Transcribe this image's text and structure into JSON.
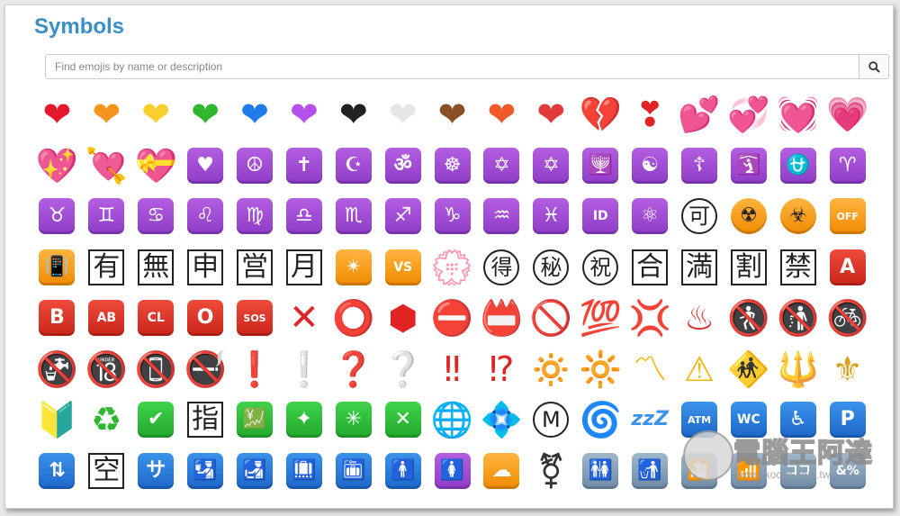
{
  "page": {
    "title": "Symbols",
    "search_placeholder": "Find emojis by name or description",
    "search_button_icon": "search-icon"
  },
  "watermark": {
    "text": "電腦王阿達",
    "url": "www.kocpc.com.tw"
  },
  "emojis": [
    {
      "name": "red-heart",
      "glyph": "❤",
      "color": "#e4182a",
      "kind": "plain"
    },
    {
      "name": "orange-heart",
      "glyph": "❤",
      "color": "#f7941d",
      "kind": "plain"
    },
    {
      "name": "yellow-heart",
      "glyph": "❤",
      "color": "#f8cf2c",
      "kind": "plain"
    },
    {
      "name": "green-heart",
      "glyph": "❤",
      "color": "#2fb82f",
      "kind": "plain"
    },
    {
      "name": "blue-heart",
      "glyph": "❤",
      "color": "#1f7bea",
      "kind": "plain"
    },
    {
      "name": "purple-heart",
      "glyph": "❤",
      "color": "#b550e8",
      "kind": "plain"
    },
    {
      "name": "black-heart",
      "glyph": "❤",
      "color": "#222222",
      "kind": "plain"
    },
    {
      "name": "white-heart",
      "glyph": "❤",
      "color": "#e6e6e6",
      "kind": "plain"
    },
    {
      "name": "brown-heart",
      "glyph": "❤",
      "color": "#8a5025",
      "kind": "plain"
    },
    {
      "name": "heart-on-fire",
      "glyph": "❤",
      "color": "#f05a28",
      "kind": "plain"
    },
    {
      "name": "mending-heart",
      "glyph": "❤",
      "color": "#e03a3a",
      "kind": "plain"
    },
    {
      "name": "broken-heart",
      "glyph": "💔",
      "color": "#e02424",
      "kind": "plain"
    },
    {
      "name": "heart-exclamation",
      "glyph": "❣",
      "color": "#e02424",
      "kind": "plain"
    },
    {
      "name": "two-hearts",
      "glyph": "💕",
      "color": "#f05aa0",
      "kind": "plain"
    },
    {
      "name": "revolving-hearts",
      "glyph": "💞",
      "color": "#f05aa0",
      "kind": "plain"
    },
    {
      "name": "beating-heart",
      "glyph": "💓",
      "color": "#f05aa0",
      "kind": "plain"
    },
    {
      "name": "growing-heart",
      "glyph": "💗",
      "color": "#f576b6",
      "kind": "plain"
    },
    {
      "name": "sparkling-heart",
      "glyph": "💖",
      "color": "#f05aa0",
      "kind": "plain"
    },
    {
      "name": "heart-with-arrow",
      "glyph": "💘",
      "color": "#f05aa0",
      "kind": "plain"
    },
    {
      "name": "heart-with-ribbon",
      "glyph": "💝",
      "color": "#f05aa0",
      "kind": "plain"
    },
    {
      "name": "heart-decoration",
      "glyph": "♥",
      "color": "",
      "kind": "purple"
    },
    {
      "name": "peace-symbol",
      "glyph": "☮",
      "color": "",
      "kind": "purple"
    },
    {
      "name": "latin-cross",
      "glyph": "✝",
      "color": "",
      "kind": "purple"
    },
    {
      "name": "star-and-crescent",
      "glyph": "☪",
      "color": "",
      "kind": "purple"
    },
    {
      "name": "om",
      "glyph": "ॐ",
      "color": "",
      "kind": "purple"
    },
    {
      "name": "wheel-of-dharma",
      "glyph": "☸",
      "color": "",
      "kind": "purple"
    },
    {
      "name": "star-of-david",
      "glyph": "✡",
      "color": "",
      "kind": "purple"
    },
    {
      "name": "dotted-six-pointed-star",
      "glyph": "✡",
      "color": "",
      "kind": "purple"
    },
    {
      "name": "menorah",
      "glyph": "🕎",
      "color": "",
      "kind": "purple"
    },
    {
      "name": "yin-yang",
      "glyph": "☯",
      "color": "",
      "kind": "purple"
    },
    {
      "name": "orthodox-cross",
      "glyph": "☦",
      "color": "",
      "kind": "purple"
    },
    {
      "name": "place-of-worship",
      "glyph": "🛐",
      "color": "",
      "kind": "purple"
    },
    {
      "name": "ophiuchus",
      "glyph": "⛎",
      "color": "",
      "kind": "purple"
    },
    {
      "name": "aries",
      "glyph": "♈",
      "color": "",
      "kind": "purple"
    },
    {
      "name": "taurus",
      "glyph": "♉",
      "color": "",
      "kind": "purple"
    },
    {
      "name": "gemini",
      "glyph": "♊",
      "color": "",
      "kind": "purple"
    },
    {
      "name": "cancer",
      "glyph": "♋",
      "color": "",
      "kind": "purple"
    },
    {
      "name": "leo",
      "glyph": "♌",
      "color": "",
      "kind": "purple"
    },
    {
      "name": "virgo",
      "glyph": "♍",
      "color": "",
      "kind": "purple"
    },
    {
      "name": "libra",
      "glyph": "♎",
      "color": "",
      "kind": "purple"
    },
    {
      "name": "scorpio",
      "glyph": "♏",
      "color": "",
      "kind": "purple"
    },
    {
      "name": "sagittarius",
      "glyph": "♐",
      "color": "",
      "kind": "purple"
    },
    {
      "name": "capricorn",
      "glyph": "♑",
      "color": "",
      "kind": "purple"
    },
    {
      "name": "aquarius",
      "glyph": "♒",
      "color": "",
      "kind": "purple"
    },
    {
      "name": "pisces",
      "glyph": "♓",
      "color": "",
      "kind": "purple"
    },
    {
      "name": "id-button",
      "glyph": "ID",
      "color": "",
      "kind": "purple-text"
    },
    {
      "name": "atom-symbol",
      "glyph": "⚛",
      "color": "",
      "kind": "purple"
    },
    {
      "name": "japanese-acceptable-button",
      "glyph": "可",
      "color": "",
      "kind": "circled"
    },
    {
      "name": "radioactive",
      "glyph": "☢",
      "color": "",
      "kind": "orange-round"
    },
    {
      "name": "biohazard",
      "glyph": "☣",
      "color": "",
      "kind": "orange-round"
    },
    {
      "name": "mobile-phone-off",
      "glyph": "OFF",
      "color": "",
      "kind": "orange-text"
    },
    {
      "name": "vibration-mode",
      "glyph": "📳",
      "color": "",
      "kind": "orange"
    },
    {
      "name": "japanese-not-free-of-charge-button",
      "glyph": "有",
      "color": "",
      "kind": "boxed"
    },
    {
      "name": "japanese-free-of-charge-button",
      "glyph": "無",
      "color": "",
      "kind": "boxed"
    },
    {
      "name": "japanese-application-button",
      "glyph": "申",
      "color": "",
      "kind": "boxed"
    },
    {
      "name": "japanese-open-for-business-button",
      "glyph": "営",
      "color": "",
      "kind": "boxed"
    },
    {
      "name": "japanese-monthly-amount-button",
      "glyph": "月",
      "color": "",
      "kind": "boxed"
    },
    {
      "name": "eight-pointed-star",
      "glyph": "✴",
      "color": "",
      "kind": "orange"
    },
    {
      "name": "vs-button",
      "glyph": "VS",
      "color": "",
      "kind": "orange-text"
    },
    {
      "name": "white-flower",
      "glyph": "💮",
      "color": "#e04040",
      "kind": "plain"
    },
    {
      "name": "japanese-bargain-button",
      "glyph": "得",
      "color": "",
      "kind": "circled"
    },
    {
      "name": "japanese-secret-button",
      "glyph": "秘",
      "color": "",
      "kind": "circled"
    },
    {
      "name": "japanese-congratulations-button",
      "glyph": "祝",
      "color": "",
      "kind": "circled"
    },
    {
      "name": "japanese-passing-grade-button",
      "glyph": "合",
      "color": "",
      "kind": "boxed"
    },
    {
      "name": "japanese-no-vacancy-button",
      "glyph": "満",
      "color": "",
      "kind": "boxed"
    },
    {
      "name": "japanese-discount-button",
      "glyph": "割",
      "color": "",
      "kind": "boxed"
    },
    {
      "name": "japanese-prohibited-button",
      "glyph": "禁",
      "color": "",
      "kind": "boxed"
    },
    {
      "name": "a-button-blood-type",
      "glyph": "A",
      "color": "",
      "kind": "red-text"
    },
    {
      "name": "b-button-blood-type",
      "glyph": "B",
      "color": "",
      "kind": "red-text"
    },
    {
      "name": "ab-button-blood-type",
      "glyph": "AB",
      "color": "",
      "kind": "red-text"
    },
    {
      "name": "cl-button",
      "glyph": "CL",
      "color": "",
      "kind": "red-text"
    },
    {
      "name": "o-button-blood-type",
      "glyph": "O",
      "color": "",
      "kind": "red-text"
    },
    {
      "name": "sos-button",
      "glyph": "SOS",
      "color": "",
      "kind": "red-text-xs"
    },
    {
      "name": "cross-mark",
      "glyph": "✕",
      "color": "#e02424",
      "kind": "plain-bold"
    },
    {
      "name": "hollow-red-circle",
      "glyph": "⭕",
      "color": "#e02424",
      "kind": "plain"
    },
    {
      "name": "stop-sign",
      "glyph": "⬢",
      "color": "#e02424",
      "kind": "plain"
    },
    {
      "name": "no-entry",
      "glyph": "⛔",
      "color": "#e02424",
      "kind": "plain"
    },
    {
      "name": "name-badge",
      "glyph": "📛",
      "color": "#e05a24",
      "kind": "plain"
    },
    {
      "name": "prohibited",
      "glyph": "🚫",
      "color": "#e02424",
      "kind": "plain"
    },
    {
      "name": "hundred-points",
      "glyph": "💯",
      "color": "#e02424",
      "kind": "plain"
    },
    {
      "name": "anger-symbol",
      "glyph": "💢",
      "color": "#e02424",
      "kind": "plain"
    },
    {
      "name": "hot-springs",
      "glyph": "♨",
      "color": "#e02424",
      "kind": "plain"
    },
    {
      "name": "no-pedestrians",
      "glyph": "🚷",
      "color": "#e02424",
      "kind": "plain"
    },
    {
      "name": "no-littering",
      "glyph": "🚯",
      "color": "#e02424",
      "kind": "plain"
    },
    {
      "name": "no-bicycles",
      "glyph": "🚳",
      "color": "#e02424",
      "kind": "plain"
    },
    {
      "name": "non-potable-water",
      "glyph": "🚱",
      "color": "#e02424",
      "kind": "plain"
    },
    {
      "name": "no-one-under-eighteen",
      "glyph": "🔞",
      "color": "#e02424",
      "kind": "plain"
    },
    {
      "name": "no-mobile-phones",
      "glyph": "📵",
      "color": "#e02424",
      "kind": "plain"
    },
    {
      "name": "no-smoking",
      "glyph": "🚭",
      "color": "#e02424",
      "kind": "plain"
    },
    {
      "name": "red-exclamation-mark",
      "glyph": "❗",
      "color": "#e02424",
      "kind": "plain"
    },
    {
      "name": "white-exclamation-mark",
      "glyph": "❕",
      "color": "#cfcfcf",
      "kind": "plain"
    },
    {
      "name": "red-question-mark",
      "glyph": "❓",
      "color": "#e02424",
      "kind": "plain"
    },
    {
      "name": "white-question-mark",
      "glyph": "❔",
      "color": "#cfcfcf",
      "kind": "plain"
    },
    {
      "name": "double-exclamation-mark",
      "glyph": "‼",
      "color": "#e02424",
      "kind": "plain"
    },
    {
      "name": "exclamation-question-mark",
      "glyph": "⁉",
      "color": "#e02424",
      "kind": "plain"
    },
    {
      "name": "dim-button",
      "glyph": "🔅",
      "color": "#f3b400",
      "kind": "plain"
    },
    {
      "name": "bright-button",
      "glyph": "🔆",
      "color": "#f3b400",
      "kind": "plain"
    },
    {
      "name": "part-alternation-mark",
      "glyph": "〽",
      "color": "#f3b400",
      "kind": "plain"
    },
    {
      "name": "warning",
      "glyph": "⚠",
      "color": "#f3b400",
      "kind": "plain"
    },
    {
      "name": "children-crossing",
      "glyph": "🚸",
      "color": "#f3b400",
      "kind": "plain"
    },
    {
      "name": "trident-emblem",
      "glyph": "🔱",
      "color": "#d6a21e",
      "kind": "plain"
    },
    {
      "name": "fleur-de-lis",
      "glyph": "⚜",
      "color": "#d6a21e",
      "kind": "plain"
    },
    {
      "name": "japanese-symbol-for-beginner",
      "glyph": "🔰",
      "color": "#2fb82f",
      "kind": "plain"
    },
    {
      "name": "recycling-symbol",
      "glyph": "♻",
      "color": "#2fb82f",
      "kind": "plain"
    },
    {
      "name": "check-mark-button",
      "glyph": "✔",
      "color": "",
      "kind": "green"
    },
    {
      "name": "japanese-reserved-button",
      "glyph": "指",
      "color": "",
      "kind": "boxed"
    },
    {
      "name": "chart-increasing-with-yen",
      "glyph": "💹",
      "color": "",
      "kind": "green"
    },
    {
      "name": "sparkle",
      "glyph": "✦",
      "color": "",
      "kind": "green"
    },
    {
      "name": "eight-spoked-asterisk",
      "glyph": "✳",
      "color": "",
      "kind": "green"
    },
    {
      "name": "cross-mark-button",
      "glyph": "✕",
      "color": "",
      "kind": "green"
    },
    {
      "name": "globe-with-meridians",
      "glyph": "🌐",
      "color": "#3b93ea",
      "kind": "plain"
    },
    {
      "name": "diamond-with-a-dot",
      "glyph": "💠",
      "color": "#3b93ea",
      "kind": "plain"
    },
    {
      "name": "circled-m",
      "glyph": "M",
      "color": "",
      "kind": "circled"
    },
    {
      "name": "cyclone",
      "glyph": "🌀",
      "color": "#3b93ea",
      "kind": "plain"
    },
    {
      "name": "zzz",
      "glyph": "zzZ",
      "color": "#3b93ea",
      "kind": "plain-text"
    },
    {
      "name": "atm-sign",
      "glyph": "ATM",
      "color": "",
      "kind": "blue-text-xs"
    },
    {
      "name": "water-closet",
      "glyph": "WC",
      "color": "",
      "kind": "blue-text"
    },
    {
      "name": "wheelchair-symbol",
      "glyph": "♿",
      "color": "",
      "kind": "blue"
    },
    {
      "name": "p-button",
      "glyph": "P",
      "color": "",
      "kind": "blue-text"
    },
    {
      "name": "elevator",
      "glyph": "⇅",
      "color": "",
      "kind": "blue"
    },
    {
      "name": "japanese-vacancy-button",
      "glyph": "空",
      "color": "",
      "kind": "boxed"
    },
    {
      "name": "japanese-service-charge-button",
      "glyph": "サ",
      "color": "",
      "kind": "blue"
    },
    {
      "name": "passport-control",
      "glyph": "🛂",
      "color": "",
      "kind": "blue"
    },
    {
      "name": "customs",
      "glyph": "🛃",
      "color": "",
      "kind": "blue"
    },
    {
      "name": "baggage-claim",
      "glyph": "🛄",
      "color": "",
      "kind": "blue"
    },
    {
      "name": "left-luggage",
      "glyph": "🛅",
      "color": "",
      "kind": "blue"
    },
    {
      "name": "mens-room",
      "glyph": "🚹",
      "color": "",
      "kind": "blue"
    },
    {
      "name": "womens-room",
      "glyph": "🚺",
      "color": "",
      "kind": "purple"
    },
    {
      "name": "cool-button",
      "glyph": "☁",
      "color": "",
      "kind": "orange"
    },
    {
      "name": "transgender-symbol",
      "glyph": "⚧",
      "color": "#333333",
      "kind": "plain"
    },
    {
      "name": "restroom",
      "glyph": "🚻",
      "color": "",
      "kind": "bluegray"
    },
    {
      "name": "litter-in-bin-sign",
      "glyph": "🚮",
      "color": "",
      "kind": "bluegray"
    },
    {
      "name": "cinema",
      "glyph": "🎦",
      "color": "",
      "kind": "bluegray"
    },
    {
      "name": "antenna-bars",
      "glyph": "📶",
      "color": "",
      "kind": "bluegray"
    },
    {
      "name": "japanese-here-button",
      "glyph": "ココ",
      "color": "",
      "kind": "bluegray-text"
    },
    {
      "name": "input-symbols",
      "glyph": "&%",
      "color": "",
      "kind": "bluegray-text"
    }
  ]
}
